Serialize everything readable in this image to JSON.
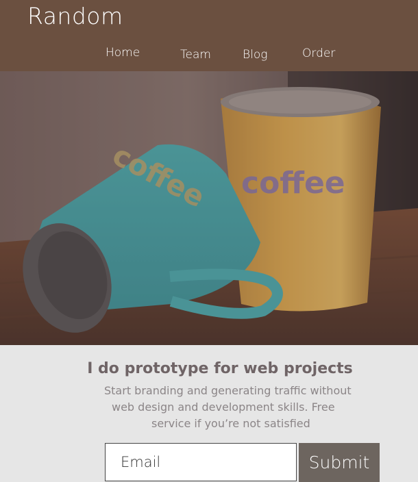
{
  "header": {
    "brand": "Random",
    "nav": [
      {
        "label": "Home"
      },
      {
        "label": "Team"
      },
      {
        "label": "Blog"
      },
      {
        "label": "Order"
      }
    ]
  },
  "hero": {
    "mug_label_left": "coffee",
    "mug_label_right": "coffee"
  },
  "content": {
    "headline": "I do prototype for web projects",
    "subtext_lines": [
      "Start branding and generating traffic without",
      "web design and development skills. Free",
      "service if you’re not satisfied"
    ]
  },
  "form": {
    "email_placeholder": "Email",
    "submit_label": "Submit"
  },
  "colors": {
    "header_bg": "#6b5040",
    "page_bg": "#e6e6e6",
    "submit_bg": "#6d655f",
    "headline": "#6f6466"
  }
}
